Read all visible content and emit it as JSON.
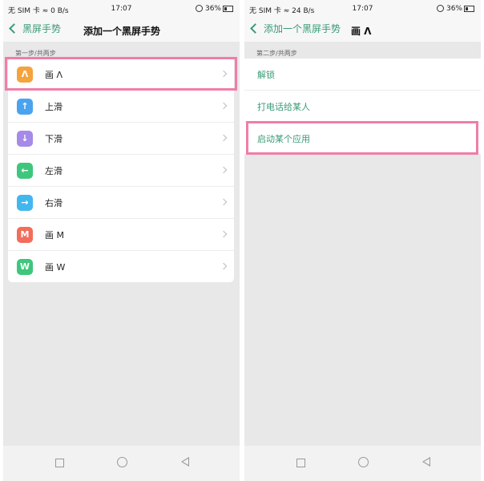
{
  "left": {
    "status": {
      "carrier": "无 SIM 卡",
      "speed": "0 B/s",
      "time": "17:07",
      "battery": "36%"
    },
    "nav": {
      "back_label": "黑屏手势",
      "title": "添加一个黑屏手势"
    },
    "step": "第一步/共两步",
    "gestures": [
      {
        "icon_text": "Λ",
        "label": "画 Λ",
        "color": "#f5a33d"
      },
      {
        "icon_text": "↑",
        "label": "上滑",
        "color": "#4aa3ef"
      },
      {
        "icon_text": "↓",
        "label": "下滑",
        "color": "#a58ae8"
      },
      {
        "icon_text": "←",
        "label": "左滑",
        "color": "#3ec77c"
      },
      {
        "icon_text": "→",
        "label": "右滑",
        "color": "#41b7ee"
      },
      {
        "icon_text": "M",
        "label": "画 M",
        "color": "#f26d5b"
      },
      {
        "icon_text": "W",
        "label": "画 W",
        "color": "#3ec77c"
      }
    ]
  },
  "right": {
    "status": {
      "carrier": "无 SIM 卡",
      "speed": "24 B/s",
      "time": "17:07",
      "battery": "36%"
    },
    "nav": {
      "back_label": "添加一个黑屏手势",
      "title": "画 Λ"
    },
    "step": "第二步/共两步",
    "actions": [
      {
        "label": "解锁"
      },
      {
        "label": "打电话给某人"
      },
      {
        "label": "启动某个应用"
      }
    ]
  },
  "highlight_color": "#f07da8",
  "accent_color": "#3a9b76"
}
